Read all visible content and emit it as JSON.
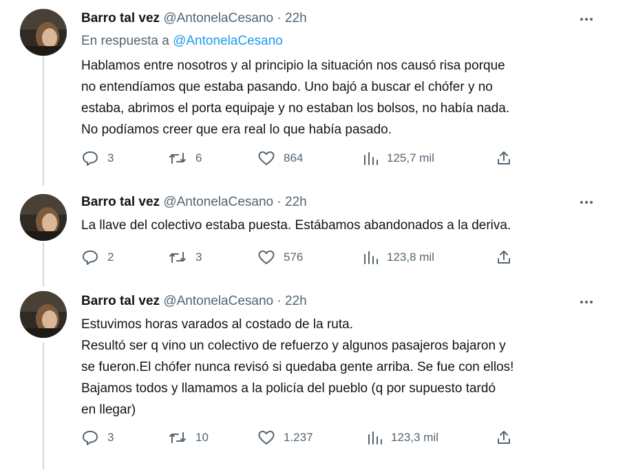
{
  "tweets": [
    {
      "author_name": "Barro tal vez",
      "handle": "@AntonelaCesano",
      "separator": "·",
      "time": "22h",
      "reply_prefix": "En respuesta a",
      "reply_mention": "@AntonelaCesano",
      "text_lines": [
        "Hablamos entre nosotros y al principio la situación nos causó risa porque",
        "no entendíamos que estaba pasando. Uno bajó a buscar el chófer y no",
        "estaba, abrimos el porta equipaje y no estaban los bolsos, no había nada.",
        "No podíamos creer que era real lo que había pasado."
      ],
      "replies": "3",
      "retweets": "6",
      "likes": "864",
      "views": "125,7 mil"
    },
    {
      "author_name": "Barro tal vez",
      "handle": "@AntonelaCesano",
      "separator": "·",
      "time": "22h",
      "text_lines": [
        "La llave del colectivo estaba puesta. Estábamos abandonados a la deriva."
      ],
      "replies": "2",
      "retweets": "3",
      "likes": "576",
      "views": "123,8 mil"
    },
    {
      "author_name": "Barro tal vez",
      "handle": "@AntonelaCesano",
      "separator": "·",
      "time": "22h",
      "text_lines": [
        "Estuvimos horas varados al costado de la ruta.",
        "Resultó ser q vino un colectivo de refuerzo y algunos pasajeros bajaron y",
        "se fueron.El chófer nunca revisó si quedaba gente arriba. Se fue con ellos!",
        "Bajamos todos y llamamos a la policía del pueblo (q por supuesto tardó",
        "en llegar)"
      ],
      "replies": "3",
      "retweets": "10",
      "likes": "1.237",
      "views": "123,3 mil"
    }
  ],
  "icons": {
    "more": "more-dots-icon",
    "reply": "reply-bubble-icon",
    "retweet": "retweet-icon",
    "like": "heart-icon",
    "views": "views-bar-icon",
    "share": "share-upload-icon"
  },
  "colors": {
    "text": "#0f1419",
    "secondary": "#536471",
    "link": "#1d9bf0",
    "thread_line": "#cfd9de"
  }
}
